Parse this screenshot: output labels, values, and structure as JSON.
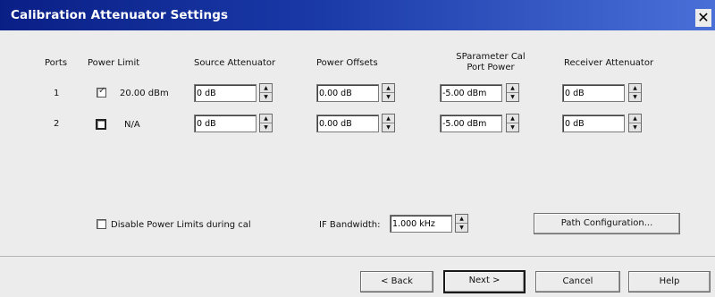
{
  "dialog": {
    "title": "Calibration Attenuator Settings",
    "close_glyph": "✕"
  },
  "headers": {
    "ports": "Ports",
    "power_limit": "Power Limit",
    "source_attenuator": "Source Attenuator",
    "power_offsets": "Power Offsets",
    "sparam_line1": "SParameter Cal",
    "sparam_line2": "Port Power",
    "receiver_attenuator": "Receiver Attenuator"
  },
  "rows": [
    {
      "port": "1",
      "power_limit_checked": true,
      "power_limit_value": "20.00 dBm",
      "source_attenuator": "0 dB",
      "power_offset": "0.00 dB",
      "sparam_port_power": "-5.00 dBm",
      "receiver_attenuator": "0 dB"
    },
    {
      "port": "2",
      "power_limit_checked": false,
      "power_limit_value": "N/A",
      "source_attenuator": "0 dB",
      "power_offset": "0.00 dB",
      "sparam_port_power": "-5.00 dBm",
      "receiver_attenuator": "0 dB"
    }
  ],
  "options": {
    "disable_power_limits_label": "Disable Power Limits during cal",
    "disable_power_limits_checked": false,
    "if_bandwidth_label": "IF Bandwidth:",
    "if_bandwidth_value": "1.000 kHz",
    "path_config_label": "Path Configuration..."
  },
  "footer": {
    "back_label": "< Back",
    "next_label": "Next >",
    "cancel_label": "Cancel",
    "help_label": "Help"
  },
  "glyphs": {
    "check": "✓",
    "spin_up": "▲",
    "spin_down": "▼"
  },
  "colors": {
    "title_bar_start": "#0a1f86",
    "title_bar_end": "#4a70d8",
    "dialog_bg": "#ececec"
  }
}
